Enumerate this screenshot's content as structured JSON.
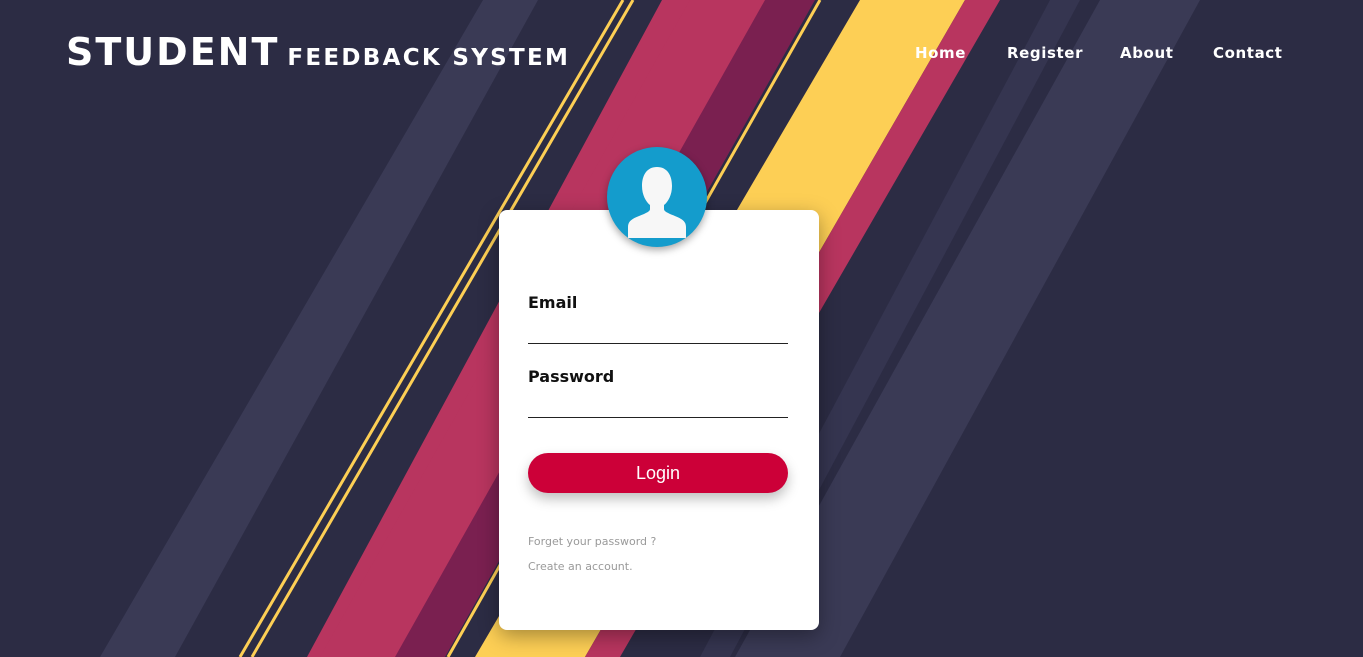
{
  "header": {
    "brand_main": "STUDENT",
    "brand_sub": "FEEDBACK SYSTEM"
  },
  "nav": {
    "home": "Home",
    "register": "Register",
    "about": "About",
    "contact": "Contact"
  },
  "login_form": {
    "email_label": "Email",
    "email_value": "",
    "password_label": "Password",
    "password_value": "",
    "login_button": "Login",
    "forgot_link": "Forget your password ?",
    "create_link": "Create an account."
  },
  "colors": {
    "background": "#2c2c44",
    "accent_pink": "#b8355f",
    "accent_yellow": "#fdcf55",
    "button_red": "#cc0038",
    "avatar_blue": "#149ccc"
  },
  "icons": {
    "avatar": "user-silhouette-icon"
  }
}
